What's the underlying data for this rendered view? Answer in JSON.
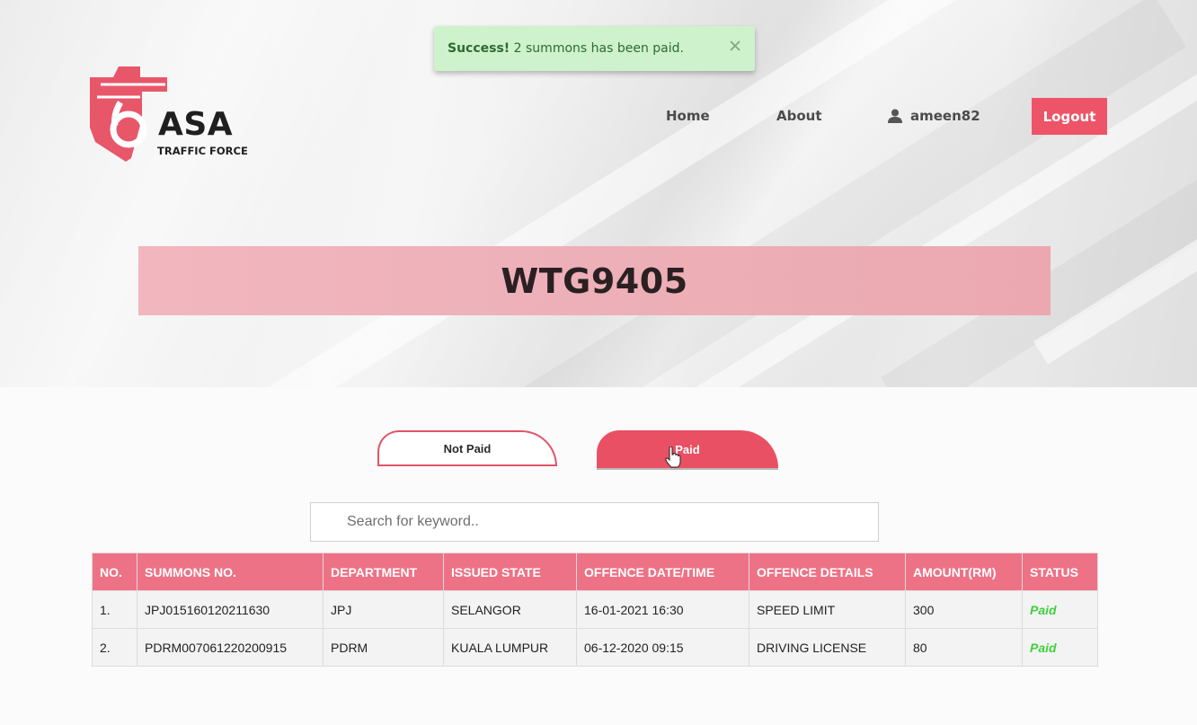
{
  "toast": {
    "strong": "Success!",
    "message": " 2 summons has been paid.",
    "close_icon": "close-icon"
  },
  "logo": {
    "name": "ASA",
    "tagline": "TRAFFIC FORCE"
  },
  "nav": {
    "home": "Home",
    "about": "About",
    "user": "ameen82",
    "user_icon": "user-icon",
    "logout": "Logout"
  },
  "page": {
    "title": "WTG9405"
  },
  "tabs": {
    "not_paid": "Not Paid",
    "paid": "Paid"
  },
  "search": {
    "placeholder": "Search for keyword..",
    "value": ""
  },
  "table": {
    "headers": [
      "NO.",
      "SUMMONS NO.",
      "DEPARTMENT",
      "ISSUED STATE",
      "OFFENCE DATE/TIME",
      "OFFENCE DETAILS",
      "AMOUNT(RM)",
      "STATUS"
    ],
    "rows": [
      [
        "1.",
        "JPJ015160120211630",
        "JPJ",
        "SELANGOR",
        "16-01-2021 16:30",
        "SPEED LIMIT",
        "300",
        "Paid"
      ],
      [
        "2.",
        "PDRM007061220200915",
        "PDRM",
        "KUALA LUMPUR",
        "06-12-2020 09:15",
        "DRIVING LICENSE",
        "80",
        "Paid"
      ]
    ]
  },
  "colors": {
    "accent": "#ee5468",
    "header": "#ee7286",
    "banner": "#efb0b8",
    "toast_bg": "#cdf2cc",
    "status_paid": "#3ecf3e"
  }
}
